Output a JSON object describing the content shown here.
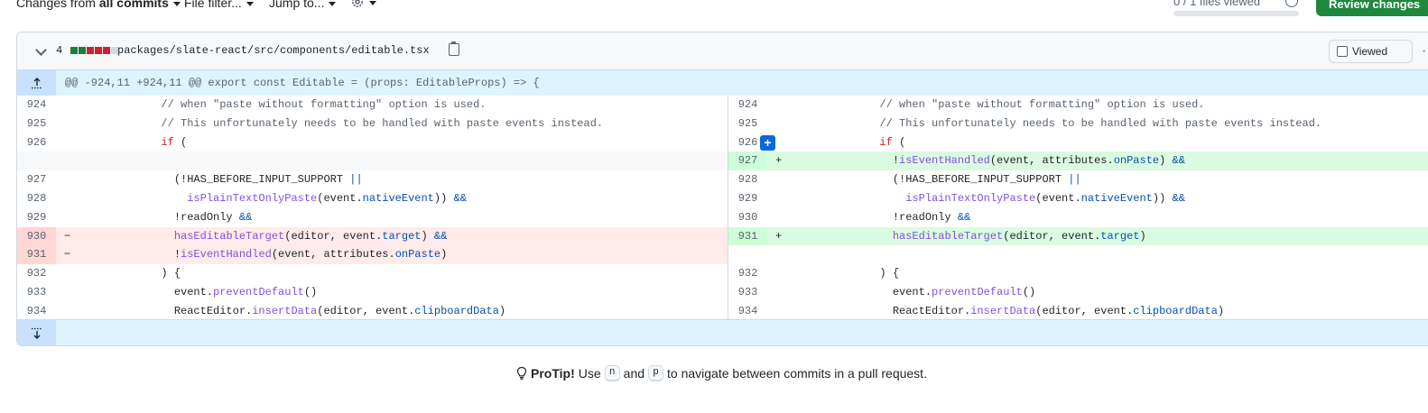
{
  "toolbar": {
    "changes_prefix": "Changes from",
    "changes_value": "all commits",
    "file_filter": "File filter...",
    "jump_to": "Jump to...",
    "settings_icon": "gear-icon",
    "files_viewed": "0 / 1 files viewed",
    "review_button": "Review changes"
  },
  "file": {
    "change_count": "4",
    "diffstat": [
      "#1a7f37",
      "#1a7f37",
      "#cf222e",
      "#cf222e",
      "#cf222e",
      "#d1d9e0"
    ],
    "path": "packages/slate-react/src/components/editable.tsx",
    "viewed_label": "Viewed",
    "hunk_header": "@@ -924,11 +924,11 @@ export const Editable = (props: EditableProps) => {"
  },
  "rows": [
    {
      "l": {
        "n": "924",
        "t": "normal",
        "m": "",
        "code": [
          [
            "            ",
            ""
          ],
          [
            "// when \"paste without formatting\" option is used.",
            "com"
          ]
        ]
      },
      "r": {
        "n": "924",
        "t": "normal",
        "m": "",
        "code": [
          [
            "            ",
            ""
          ],
          [
            "// when \"paste without formatting\" option is used.",
            "com"
          ]
        ]
      }
    },
    {
      "l": {
        "n": "925",
        "t": "normal",
        "m": "",
        "code": [
          [
            "            ",
            ""
          ],
          [
            "// This unfortunately needs to be handled with paste events instead.",
            "com"
          ]
        ]
      },
      "r": {
        "n": "925",
        "t": "normal",
        "m": "",
        "code": [
          [
            "            ",
            ""
          ],
          [
            "// This unfortunately needs to be handled with paste events instead.",
            "com"
          ]
        ]
      }
    },
    {
      "l": {
        "n": "926",
        "t": "normal",
        "m": "",
        "code": [
          [
            "            ",
            ""
          ],
          [
            "if",
            "kw"
          ],
          [
            " (",
            ""
          ]
        ]
      },
      "r": {
        "n": "926",
        "t": "normal",
        "m": "",
        "plus": true,
        "code": [
          [
            "            ",
            ""
          ],
          [
            "if",
            "kw"
          ],
          [
            " (",
            ""
          ]
        ]
      }
    },
    {
      "l": {
        "n": "",
        "t": "empty",
        "m": "",
        "code": []
      },
      "r": {
        "n": "927",
        "t": "add",
        "m": "+",
        "code": [
          [
            "              !",
            ""
          ],
          [
            "isEventHandled",
            "fn"
          ],
          [
            "(event, attributes.",
            ""
          ],
          [
            "onPaste",
            "prop"
          ],
          [
            ") ",
            ""
          ],
          [
            "&&",
            "op"
          ]
        ]
      }
    },
    {
      "l": {
        "n": "927",
        "t": "normal",
        "m": "",
        "code": [
          [
            "              (!HAS_BEFORE_INPUT_SUPPORT ",
            ""
          ],
          [
            "||",
            "op"
          ]
        ]
      },
      "r": {
        "n": "928",
        "t": "normal",
        "m": "",
        "code": [
          [
            "              (!HAS_BEFORE_INPUT_SUPPORT ",
            ""
          ],
          [
            "||",
            "op"
          ]
        ]
      }
    },
    {
      "l": {
        "n": "928",
        "t": "normal",
        "m": "",
        "code": [
          [
            "                ",
            ""
          ],
          [
            "isPlainTextOnlyPaste",
            "fn"
          ],
          [
            "(event.",
            ""
          ],
          [
            "nativeEvent",
            "prop"
          ],
          [
            ")) ",
            ""
          ],
          [
            "&&",
            "op"
          ]
        ]
      },
      "r": {
        "n": "929",
        "t": "normal",
        "m": "",
        "code": [
          [
            "                ",
            ""
          ],
          [
            "isPlainTextOnlyPaste",
            "fn"
          ],
          [
            "(event.",
            ""
          ],
          [
            "nativeEvent",
            "prop"
          ],
          [
            ")) ",
            ""
          ],
          [
            "&&",
            "op"
          ]
        ]
      }
    },
    {
      "l": {
        "n": "929",
        "t": "normal",
        "m": "",
        "code": [
          [
            "              !readOnly ",
            ""
          ],
          [
            "&&",
            "op"
          ]
        ]
      },
      "r": {
        "n": "930",
        "t": "normal",
        "m": "",
        "code": [
          [
            "              !readOnly ",
            ""
          ],
          [
            "&&",
            "op"
          ]
        ]
      }
    },
    {
      "l": {
        "n": "930",
        "t": "del",
        "m": "−",
        "code": [
          [
            "              ",
            ""
          ],
          [
            "hasEditableTarget",
            "fn"
          ],
          [
            "(editor, event.",
            ""
          ],
          [
            "target",
            "prop"
          ],
          [
            ") ",
            ""
          ],
          [
            "&&",
            "op"
          ]
        ]
      },
      "r": {
        "n": "931",
        "t": "add",
        "m": "+",
        "code": [
          [
            "              ",
            ""
          ],
          [
            "hasEditableTarget",
            "fn"
          ],
          [
            "(editor, event.",
            ""
          ],
          [
            "target",
            "prop"
          ],
          [
            ")",
            ""
          ]
        ]
      }
    },
    {
      "l": {
        "n": "931",
        "t": "del",
        "m": "−",
        "code": [
          [
            "              !",
            ""
          ],
          [
            "isEventHandled",
            "fn"
          ],
          [
            "(event, attributes.",
            ""
          ],
          [
            "onPaste",
            "prop"
          ],
          [
            ")",
            ""
          ]
        ]
      },
      "r": {
        "n": "",
        "t": "blank",
        "m": "",
        "code": []
      }
    },
    {
      "l": {
        "n": "932",
        "t": "normal",
        "m": "",
        "code": [
          [
            "            ) {",
            ""
          ]
        ]
      },
      "r": {
        "n": "932",
        "t": "normal",
        "m": "",
        "code": [
          [
            "            ) {",
            ""
          ]
        ]
      }
    },
    {
      "l": {
        "n": "933",
        "t": "normal",
        "m": "",
        "code": [
          [
            "              event.",
            ""
          ],
          [
            "preventDefault",
            "fn"
          ],
          [
            "()",
            ""
          ]
        ]
      },
      "r": {
        "n": "933",
        "t": "normal",
        "m": "",
        "code": [
          [
            "              event.",
            ""
          ],
          [
            "preventDefault",
            "fn"
          ],
          [
            "()",
            ""
          ]
        ]
      }
    },
    {
      "l": {
        "n": "934",
        "t": "normal",
        "m": "",
        "code": [
          [
            "              ReactEditor.",
            ""
          ],
          [
            "insertData",
            "fn"
          ],
          [
            "(editor, event.",
            ""
          ],
          [
            "clipboardData",
            "prop"
          ],
          [
            ")",
            ""
          ]
        ]
      },
      "r": {
        "n": "934",
        "t": "normal",
        "m": "",
        "code": [
          [
            "              ReactEditor.",
            ""
          ],
          [
            "insertData",
            "fn"
          ],
          [
            "(editor, event.",
            ""
          ],
          [
            "clipboardData",
            "prop"
          ],
          [
            ")",
            ""
          ]
        ]
      }
    }
  ],
  "protip": {
    "icon": "lightbulb-icon",
    "title": "ProTip!",
    "use": "Use",
    "key1": "n",
    "and": "and",
    "key2": "p",
    "rest": "to navigate between commits in a pull request."
  }
}
